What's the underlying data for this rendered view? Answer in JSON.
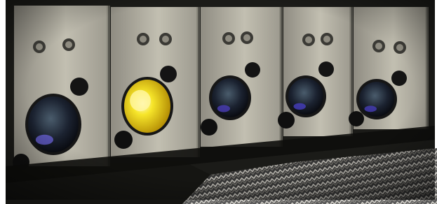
{
  "scene": {
    "panels": [
      {
        "lens_state": "off",
        "lens_color": "#2a2f6a",
        "glow_color": "#6b63d9"
      },
      {
        "lens_state": "on",
        "lens_color": "#f4e11c",
        "glow_color": "#fff6a6"
      },
      {
        "lens_state": "off",
        "lens_color": "#243a45",
        "glow_color": "#4e3fbf"
      },
      {
        "lens_state": "off",
        "lens_color": "#24404a",
        "glow_color": "#4a40c8"
      },
      {
        "lens_state": "off",
        "lens_color": "#1f3f44",
        "glow_color": "#4a3fc0"
      }
    ],
    "colors": {
      "backdrop": "#1b1b18",
      "panel_face": "#b7b4a6",
      "panel_shadow": "#7f7d73",
      "floor_pattern": "#c8c5bd"
    }
  }
}
